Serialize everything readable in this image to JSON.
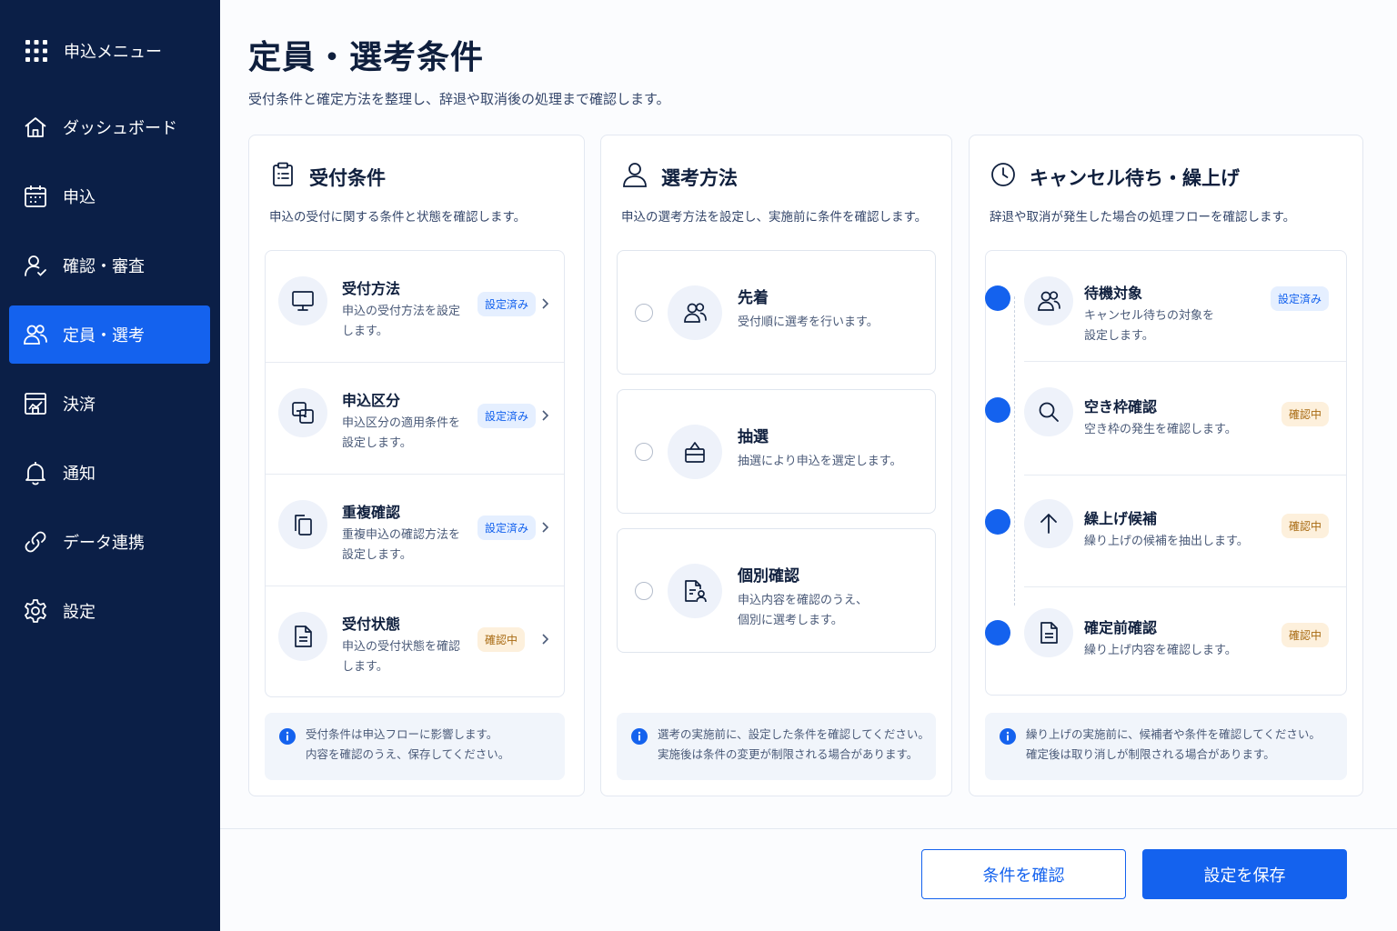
{
  "sidebar": {
    "brand": "申込メニュー",
    "items": [
      {
        "label": "ダッシュボード",
        "icon": "home-icon"
      },
      {
        "label": "申込",
        "icon": "calendar-icon"
      },
      {
        "label": "確認・審査",
        "icon": "user-check-icon"
      },
      {
        "label": "定員・選考",
        "icon": "users-icon",
        "active": true
      },
      {
        "label": "決済",
        "icon": "payment-icon"
      },
      {
        "label": "通知",
        "icon": "bell-icon"
      },
      {
        "label": "データ連携",
        "icon": "link-icon"
      },
      {
        "label": "設定",
        "icon": "gear-icon"
      }
    ]
  },
  "header": {
    "title": "定員・選考条件",
    "subtitle": "受付条件と確定方法を整理し、辞退や取消後の処理まで確認します。"
  },
  "panels": {
    "reception": {
      "title": "受付条件",
      "desc": "申込の受付に関する条件と状態を確認します。",
      "rows": [
        {
          "title": "受付方法",
          "desc": "申込の受付方法を設定します。",
          "badge": "設定済み"
        },
        {
          "title": "申込区分",
          "desc": "申込区分の適用条件を設定します。",
          "badge": "設定済み"
        },
        {
          "title": "重複確認",
          "desc": "重複申込の確認方法を設定します。",
          "badge": "設定済み"
        },
        {
          "title": "受付状態",
          "desc": "申込の受付状態を確認します。",
          "badge": "確認中"
        }
      ],
      "info_line1": "受付条件は申込フローに影響します。",
      "info_line2": "内容を確認のうえ、保存してください。"
    },
    "selection": {
      "title": "選考方法",
      "desc": "申込の選考方法を設定し、実施前に条件を確認します。",
      "options": [
        {
          "title": "先着",
          "desc_line1": "受付順に選考を行います。",
          "desc_line2": ""
        },
        {
          "title": "抽選",
          "desc_line1": "抽選により申込を選定します。",
          "desc_line2": ""
        },
        {
          "title": "個別確認",
          "desc_line1": "申込内容を確認のうえ、",
          "desc_line2": "個別に選考します。"
        }
      ],
      "info_line1": "選考の実施前に、設定した条件を確認してください。",
      "info_line2": "実施後は条件の変更が制限される場合があります。"
    },
    "waitlist": {
      "title": "キャンセル待ち・繰上げ",
      "desc": "辞退や取消が発生した場合の処理フローを確認します。",
      "steps": [
        {
          "title": "待機対象",
          "desc_line1": "キャンセル待ちの対象を",
          "desc_line2": "設定します。",
          "badge": "設定済み"
        },
        {
          "title": "空き枠確認",
          "desc_line1": "空き枠の発生を確認します。",
          "desc_line2": "",
          "badge": "確認中"
        },
        {
          "title": "繰上げ候補",
          "desc_line1": "繰り上げの候補を抽出します。",
          "desc_line2": "",
          "badge": "確認中"
        },
        {
          "title": "確定前確認",
          "desc_line1": "繰り上げ内容を確認します。",
          "desc_line2": "",
          "badge": "確認中"
        }
      ],
      "info_line1": "繰り上げの実施前に、候補者や条件を確認してください。",
      "info_line2": "確定後は取り消しが制限される場合があります。"
    }
  },
  "actions": {
    "check": "条件を確認",
    "save": "設定を保存"
  },
  "colors": {
    "sidebar_bg": "#0b1f47",
    "accent": "#1462ee",
    "badge_done_bg": "#e5efff",
    "badge_pending_bg": "#fdf0dc"
  }
}
